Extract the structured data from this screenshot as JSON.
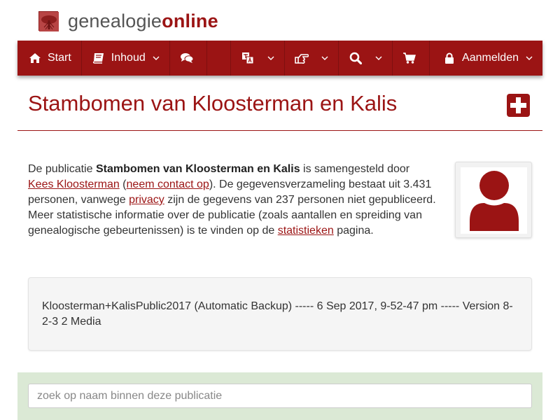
{
  "brand": {
    "part1": "genealogie",
    "part2": "online"
  },
  "nav": {
    "start": "Start",
    "inhoud": "Inhoud",
    "aanmelden": "Aanmelden"
  },
  "page": {
    "title": "Stambomen van Kloosterman en Kalis"
  },
  "intro": {
    "t1": "De publicatie ",
    "pub_name": "Stambomen van Kloosterman en Kalis",
    "t2": " is samengesteld door ",
    "author_link": "Kees Kloosterman",
    "t3": " (",
    "contact_link": "neem contact op",
    "t4": "). De gegevensverzameling bestaat uit 3.431 personen, vanwege ",
    "privacy_link": "privacy",
    "t5": " zijn de gegevens van 237 personen niet gepubliceerd. Meer statistische informatie over de publicatie (zoals aantallen en spreiding van genealogische gebeurtenissen) is te vinden op de ",
    "stats_link": "statistieken",
    "t6": " pagina."
  },
  "backup": {
    "text": "Kloosterman+KalisPublic2017 (Automatic Backup) ----- 6 Sep 2017, 9-52-47 pm ----- Version 8-2-3 2 Media"
  },
  "search": {
    "placeholder": "zoek op naam binnen deze publicatie",
    "value": ""
  },
  "colors": {
    "brand": "#9b1414",
    "search_band": "#dbe9d5"
  }
}
